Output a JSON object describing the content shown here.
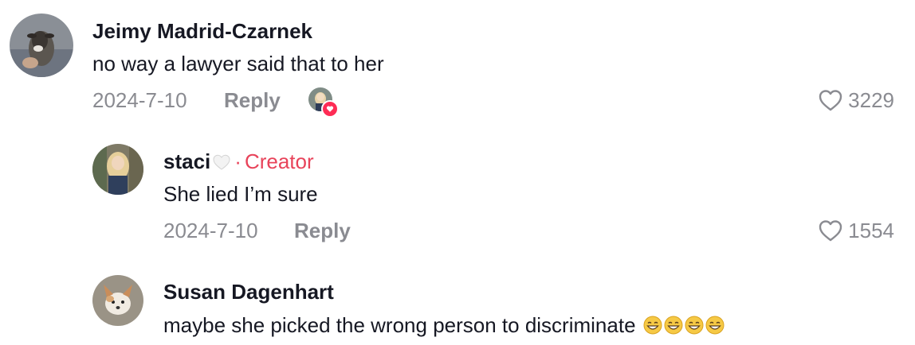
{
  "comments": [
    {
      "username": "Jeimy Madrid-Czarnek",
      "text": "no way a lawyer said that to her",
      "date": "2024-7-10",
      "reply_label": "Reply",
      "likes": "3229",
      "avatar_icon": "goat-photo-avatar",
      "liked_by_creator": true
    },
    {
      "username": "staci",
      "username_emoji": "white-heart",
      "creator_label": "Creator",
      "separator": "·",
      "text": "She lied I’m sure",
      "date": "2024-7-10",
      "reply_label": "Reply",
      "likes": "1554",
      "avatar_icon": "woman-photo-avatar"
    },
    {
      "username": "Susan Dagenhart",
      "text": "maybe she picked the wrong person to discriminate",
      "text_emojis": [
        "grinning-face-with-smiling-eyes",
        "grinning-face-with-smiling-eyes",
        "grinning-face-with-smiling-eyes",
        "grinning-face-with-smiling-eyes"
      ],
      "avatar_icon": "dog-photo-avatar"
    }
  ],
  "colors": {
    "text": "#161823",
    "muted": "#8a8b91",
    "creator": "#e8435a",
    "like_red": "#fe2c55"
  }
}
